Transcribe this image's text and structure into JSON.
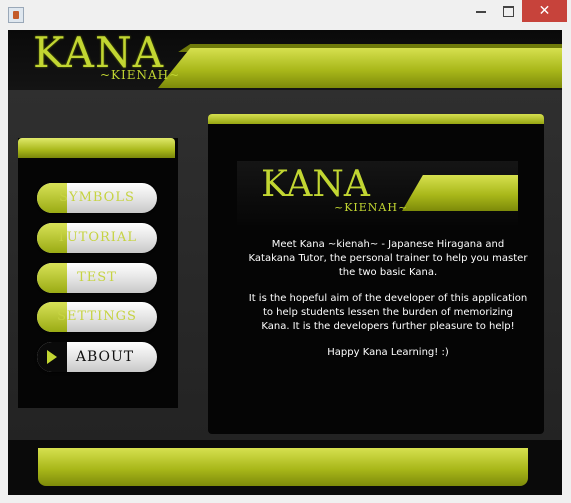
{
  "window": {
    "close_glyph": "✕"
  },
  "header": {
    "logo_title": "KANA",
    "logo_subtitle": "~KIENAH~"
  },
  "sidebar": {
    "items": [
      {
        "label": "SYMBOLS",
        "active": false
      },
      {
        "label": "TUTORIAL",
        "active": false
      },
      {
        "label": "TEST",
        "active": false
      },
      {
        "label": "SETTINGS",
        "active": false
      },
      {
        "label": "ABOUT",
        "active": true
      }
    ]
  },
  "main": {
    "logo_title": "KANA",
    "logo_subtitle": "~KIENAH~",
    "paragraphs": [
      "Meet Kana ~kienah~ - Japanese Hiragana and Katakana Tutor, the personal trainer to help you master the two basic Kana.",
      "It is the hopeful aim of the developer of this application to help students lessen the burden of memorizing Kana. It is the developers further pleasure to help!",
      "Happy Kana Learning! :)"
    ]
  },
  "colors": {
    "accent": "#b5c624",
    "background": "#2b2b2b",
    "panel": "#050505"
  }
}
